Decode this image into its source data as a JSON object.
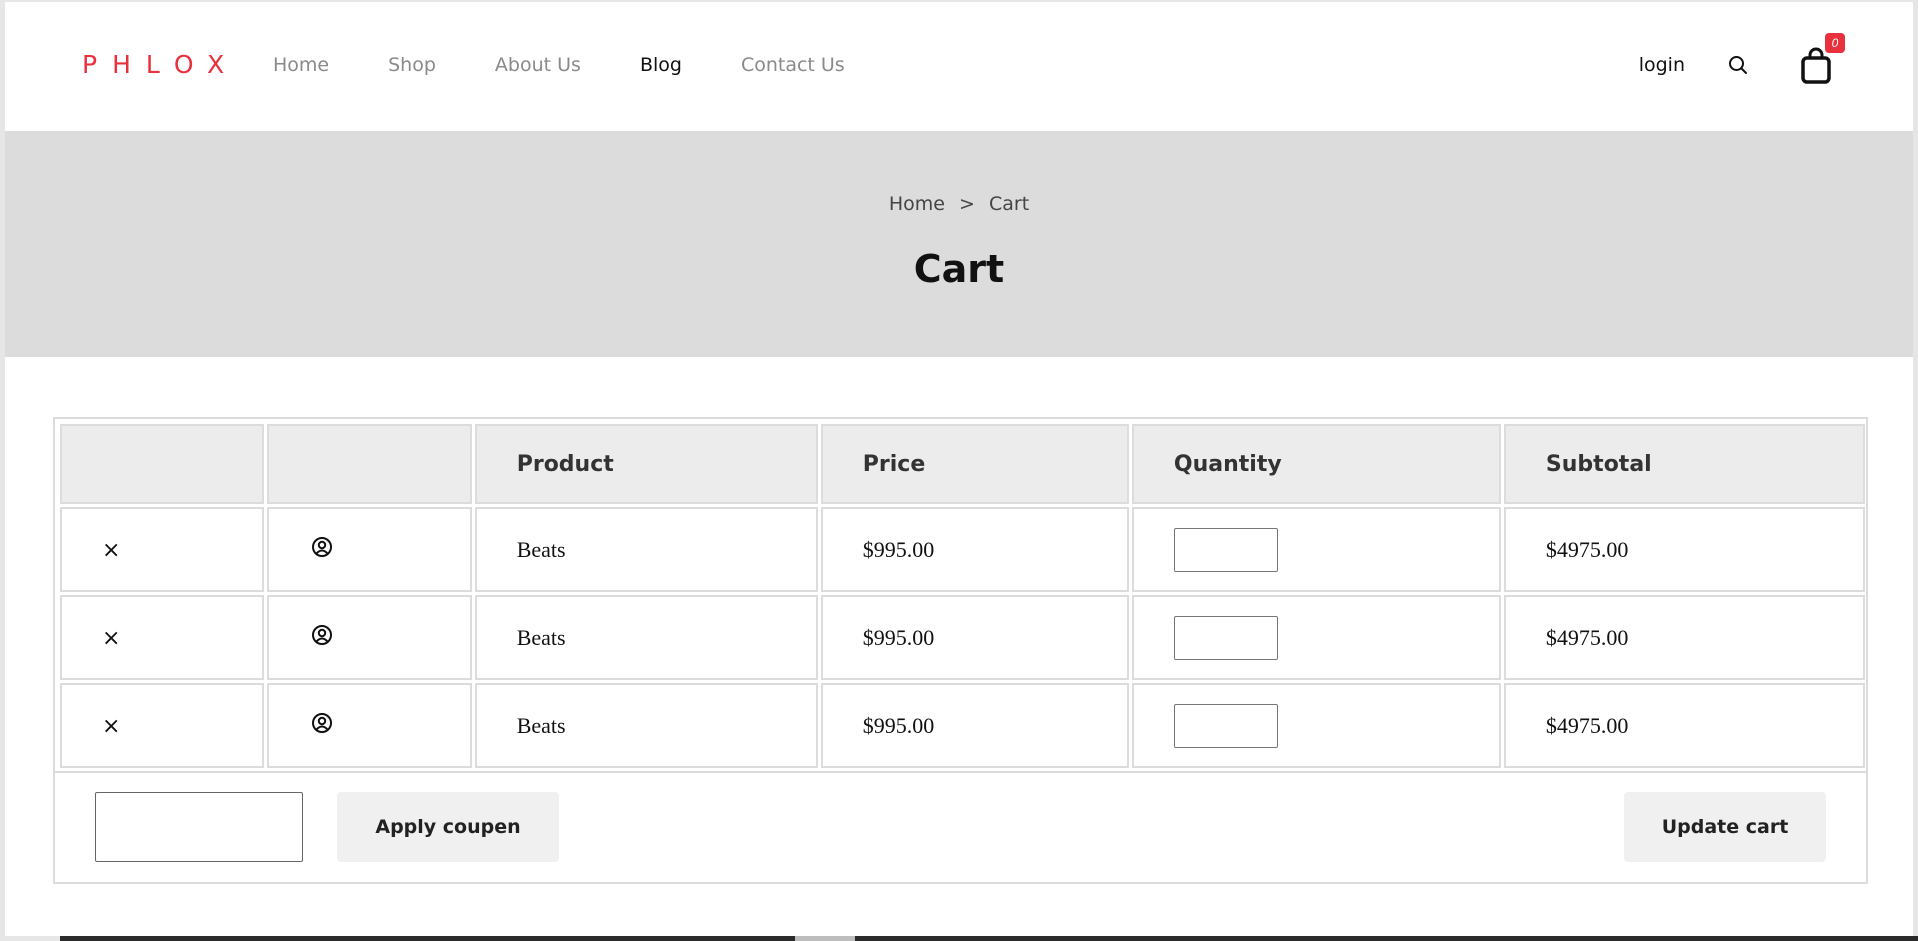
{
  "header": {
    "logo": "PHLOX",
    "nav": [
      {
        "label": "Home",
        "active": false
      },
      {
        "label": "Shop",
        "active": false
      },
      {
        "label": "About Us",
        "active": false
      },
      {
        "label": "Blog",
        "active": true
      },
      {
        "label": "Contact Us",
        "active": false
      }
    ],
    "login_label": "login",
    "search_icon": "search-icon",
    "cart_icon": "shopping-bag-icon",
    "cart_count": "0"
  },
  "banner": {
    "breadcrumb": {
      "home": "Home",
      "separator": ">",
      "current": "Cart"
    },
    "title": "Cart"
  },
  "cart": {
    "columns": [
      "",
      "",
      "Product",
      "Price",
      "Quantity",
      "Subtotal"
    ],
    "rows": [
      {
        "remove": "×",
        "thumb_icon": "user-circle-icon",
        "product": "Beats",
        "price": "$995.00",
        "quantity": "",
        "subtotal": "$4975.00"
      },
      {
        "remove": "×",
        "thumb_icon": "user-circle-icon",
        "product": "Beats",
        "price": "$995.00",
        "quantity": "",
        "subtotal": "$4975.00"
      },
      {
        "remove": "×",
        "thumb_icon": "user-circle-icon",
        "product": "Beats",
        "price": "$995.00",
        "quantity": "",
        "subtotal": "$4975.00"
      }
    ],
    "coupon_value": "",
    "apply_label": "Apply coupen",
    "update_label": "Update cart"
  },
  "colors": {
    "brand": "#e8313d",
    "banner_bg": "#dcdcdc",
    "header_cell_bg": "#ececec",
    "button_bg": "#f0f0f0"
  }
}
